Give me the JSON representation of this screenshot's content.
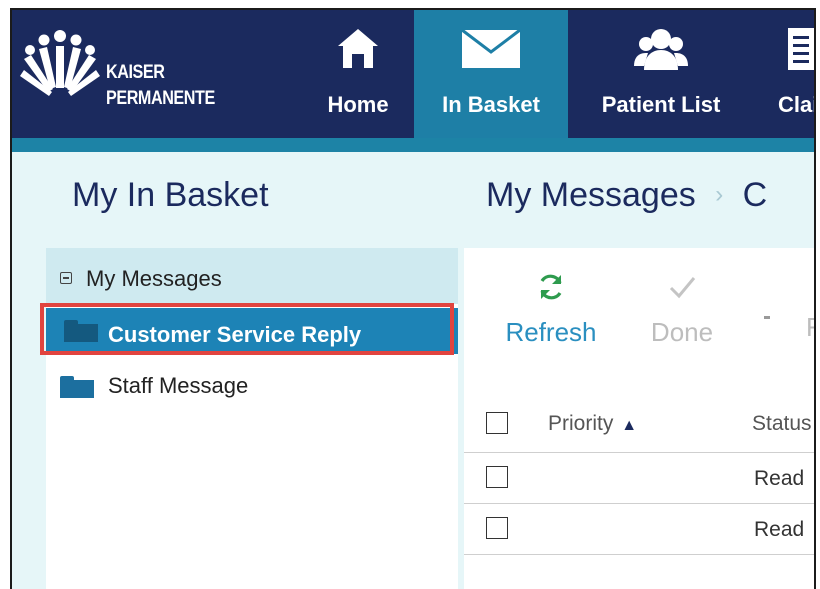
{
  "brand": {
    "line1": "KAISER",
    "line2": "PERMANENTE"
  },
  "nav": [
    {
      "label": "Home",
      "icon": "home-icon"
    },
    {
      "label": "In Basket",
      "icon": "envelope-icon"
    },
    {
      "label": "Patient List",
      "icon": "people-icon"
    },
    {
      "label": "Clai",
      "icon": "document-icon"
    }
  ],
  "titles": {
    "left": "My In Basket",
    "right": "My Messages",
    "breadcrumb_next": "C"
  },
  "folders": {
    "group_label": "My Messages",
    "items": [
      {
        "label": "Customer Service Reply",
        "selected": true
      },
      {
        "label": "Staff Message",
        "selected": false
      }
    ]
  },
  "toolbar": {
    "refresh": "Refresh",
    "done": "Done",
    "more": "F"
  },
  "table": {
    "columns": {
      "priority": "Priority",
      "priority_sort": "▲",
      "status": "Status"
    },
    "rows": [
      {
        "status": "Read"
      },
      {
        "status": "Read"
      }
    ]
  },
  "colors": {
    "header": "#1b2a5e",
    "active_tab": "#1e7fa6",
    "selected_row": "#1d83b6",
    "highlight": "#e1443f",
    "refresh": "#2e9b4e"
  }
}
